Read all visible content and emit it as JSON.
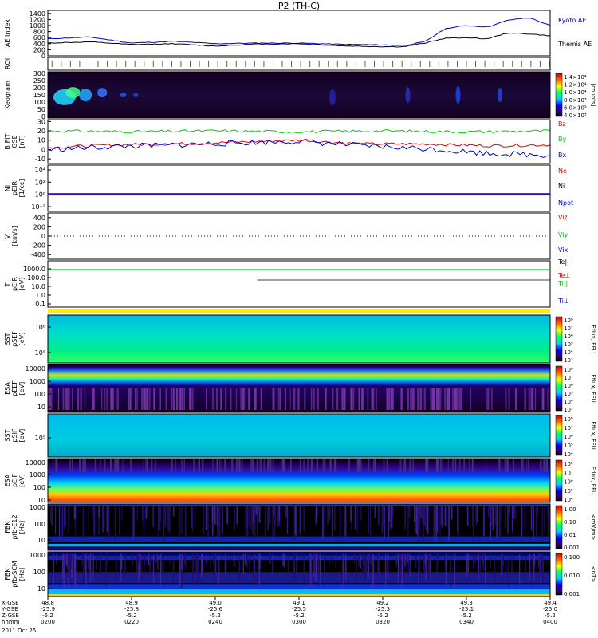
{
  "title": "P2 (TH-C)",
  "chart_data": {
    "type": "line",
    "time_axis": {
      "ticks": [
        "0200",
        "0220",
        "0240",
        "0300",
        "0320",
        "0340",
        "0400"
      ],
      "rows": [
        {
          "label": "X-GSE",
          "values": [
            "48.8",
            "48.9",
            "49.0",
            "49.1",
            "49.2",
            "49.3",
            "49.4"
          ]
        },
        {
          "label": "Y-GSE",
          "values": [
            "-25.9",
            "-25.8",
            "-25.6",
            "-25.5",
            "-25.3",
            "-25.1",
            "-25.0"
          ]
        },
        {
          "label": "Z-GSE",
          "values": [
            "-5.2",
            "-5.2",
            "-5.2",
            "-5.2",
            "-5.2",
            "-5.2",
            "-5.2"
          ]
        },
        {
          "label": "hhmm",
          "values": [
            "0200",
            "0220",
            "0240",
            "0300",
            "0320",
            "0340",
            "0400"
          ]
        }
      ],
      "date": "2011 Oct 25",
      "range": [
        "0200",
        "0400"
      ]
    },
    "panels": [
      {
        "id": "ae",
        "type": "line",
        "ylabel": [
          "AE Index"
        ],
        "yticks": [
          "1400",
          "1200",
          "1000",
          "800",
          "600",
          "400",
          "200",
          "0"
        ],
        "ylim": [
          0,
          1500
        ],
        "legend": [
          {
            "name": "Kyoto AE",
            "color": "#0000cc"
          },
          {
            "name": "Themis AE",
            "color": "#000000"
          }
        ],
        "series": [
          {
            "name": "Kyoto AE",
            "color": "#0000cc",
            "x": [
              0,
              10,
              20,
              30,
              40,
              50,
              60,
              70,
              80,
              85,
              90,
              95,
              100,
              105,
              110,
              115,
              120
            ],
            "y": [
              560,
              620,
              420,
              480,
              400,
              420,
              420,
              380,
              360,
              340,
              460,
              900,
              1000,
              950,
              1180,
              1260,
              1000
            ]
          },
          {
            "name": "Themis AE",
            "color": "#000000",
            "x": [
              0,
              10,
              20,
              30,
              40,
              50,
              60,
              70,
              80,
              85,
              90,
              95,
              100,
              105,
              110,
              115,
              120
            ],
            "y": [
              420,
              460,
              370,
              400,
              320,
              390,
              400,
              330,
              300,
              300,
              420,
              580,
              600,
              560,
              760,
              720,
              660
            ]
          }
        ]
      },
      {
        "id": "roi",
        "type": "bar",
        "ylabel": [
          "ROI"
        ],
        "note": "region-of-interest tick marks"
      },
      {
        "id": "keogram",
        "type": "heatmap",
        "ylabel": [
          "Keogram"
        ],
        "yticks": [
          "300",
          "250",
          "200",
          "150",
          "100",
          "50",
          "0"
        ],
        "ylim": [
          0,
          300
        ],
        "colorbar": {
          "ticks": [
            "1.4×10⁴",
            "1.2×10⁴",
            "1.0×10⁴",
            "8.0×10³",
            "6.0×10³",
            "4.0×10³"
          ],
          "label": "[counts]"
        }
      },
      {
        "id": "bfield",
        "type": "line",
        "ylabel": [
          "B FIT",
          "GSE",
          "[nT]"
        ],
        "yticks": [
          "30",
          "20",
          "10",
          "0",
          "-10"
        ],
        "ylim": [
          -15,
          32
        ],
        "legend": [
          {
            "name": "Bz",
            "color": "#dd0000"
          },
          {
            "name": "By",
            "color": "#00bb00"
          },
          {
            "name": "Bx",
            "color": "#0000cc"
          }
        ],
        "series": [
          {
            "name": "By",
            "color": "#00cc00",
            "x": [
              0,
              20,
              40,
              60,
              80,
              100,
              120
            ],
            "y": [
              20,
              19,
              20,
              19,
              20,
              19,
              20
            ]
          },
          {
            "name": "Bz",
            "color": "#dd0000",
            "x": [
              0,
              15,
              30,
              45,
              60,
              75,
              90,
              105,
              120
            ],
            "y": [
              2,
              5,
              6,
              8,
              10,
              6,
              6,
              4,
              5
            ]
          },
          {
            "name": "Bx",
            "color": "#0000cc",
            "x": [
              0,
              15,
              30,
              45,
              60,
              75,
              90,
              105,
              120
            ],
            "y": [
              0,
              3,
              5,
              7,
              9,
              4,
              1,
              -4,
              -6
            ]
          }
        ]
      },
      {
        "id": "density",
        "type": "line",
        "ylabel": [
          "Ni",
          "pEIR",
          "[1/cc]"
        ],
        "yticks": [
          "10⁴",
          "10²",
          "10⁰",
          "10⁻²"
        ],
        "legend": [
          {
            "name": "Ne",
            "color": "#dd0000"
          },
          {
            "name": "Ni",
            "color": "#000000"
          },
          {
            "name": "Npot",
            "color": "#0000cc"
          }
        ]
      },
      {
        "id": "velocity",
        "type": "line",
        "ylabel": [
          "Vi",
          "[km/s]"
        ],
        "yticks": [
          "400",
          "200",
          "0",
          "-200",
          "-400"
        ],
        "ylim": [
          -500,
          500
        ],
        "legend": [
          {
            "name": "Viz",
            "color": "#dd0000"
          },
          {
            "name": "Viy",
            "color": "#00bb00"
          },
          {
            "name": "Vix",
            "color": "#0000cc"
          }
        ]
      },
      {
        "id": "temperature",
        "type": "line",
        "ylabel": [
          "Ti",
          "pEIR",
          "[eV]"
        ],
        "yticks": [
          "1000.0",
          "100.0",
          "10.0",
          "1.0",
          "0.1"
        ],
        "legend": [
          {
            "name": "Te||",
            "color": "#000000"
          },
          {
            "name": "Te⊥",
            "color": "#dd0000"
          },
          {
            "name": "Ti||",
            "color": "#00bb00"
          },
          {
            "name": "Ti⊥",
            "color": "#0000cc"
          }
        ]
      },
      {
        "id": "sst_e",
        "type": "heatmap",
        "ylabel": [
          "SST",
          "pSEF",
          "[eV]"
        ],
        "yticks": [
          "10⁶",
          "10⁵"
        ],
        "colorbar": {
          "ticks": [
            "10⁸",
            "10⁷",
            "10⁶",
            "10⁵",
            "10⁴",
            "10³"
          ],
          "label": "Eflux, EFU"
        }
      },
      {
        "id": "esa_e",
        "type": "heatmap",
        "ylabel": [
          "ESA",
          "pEEF",
          "[eV]"
        ],
        "yticks": [
          "10000",
          "1000",
          "100",
          "10"
        ],
        "colorbar": {
          "ticks": [
            "10⁸",
            "10⁷",
            "10⁶",
            "10⁵",
            "10⁴",
            "10³"
          ],
          "label": "Eflux, EFU"
        }
      },
      {
        "id": "sst_i",
        "type": "heatmap",
        "ylabel": [
          "SST",
          "pSIF",
          "[eV]"
        ],
        "yticks": [
          "10⁵"
        ],
        "colorbar": {
          "ticks": [
            "10⁸",
            "10⁷",
            "10⁶",
            "10⁵",
            "10⁴"
          ],
          "label": "Eflux, EFU"
        }
      },
      {
        "id": "esa_i",
        "type": "heatmap",
        "ylabel": [
          "ESA",
          "pEIF",
          "[eV]"
        ],
        "yticks": [
          "10000",
          "1000",
          "100",
          "10"
        ],
        "colorbar": {
          "ticks": [
            "10⁸",
            "10⁷",
            "10⁶",
            "10⁵",
            "10⁴"
          ],
          "label": "Eflux, EFU"
        }
      },
      {
        "id": "fbk_e",
        "type": "heatmap",
        "ylabel": [
          "FBK",
          "pfb-E12",
          "[Hz]"
        ],
        "yticks": [
          "1000",
          "100",
          "10"
        ],
        "colorbar": {
          "ticks": [
            "1.00",
            "0.10",
            "0.01",
            "0.001"
          ],
          "label": "<mV/m>"
        }
      },
      {
        "id": "fbk_b",
        "type": "heatmap",
        "ylabel": [
          "FBK",
          "pfb-SCM",
          "[Hz]"
        ],
        "yticks": [
          "1000",
          "100",
          "10"
        ],
        "colorbar": {
          "ticks": [
            "0.100",
            "0.010",
            "0.001"
          ],
          "label": "<nT>"
        }
      }
    ]
  }
}
